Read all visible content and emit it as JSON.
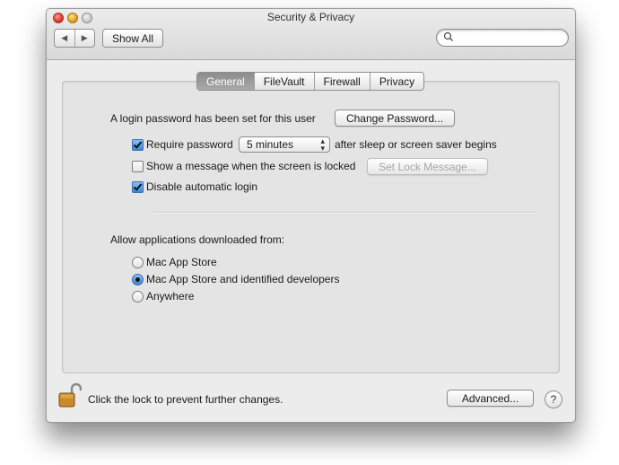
{
  "window": {
    "title": "Security & Privacy",
    "nav_back": "◀",
    "nav_forward": "▶",
    "show_all_label": "Show All",
    "search_placeholder": ""
  },
  "tabs": [
    {
      "label": "General",
      "selected": true
    },
    {
      "label": "FileVault",
      "selected": false
    },
    {
      "label": "Firewall",
      "selected": false
    },
    {
      "label": "Privacy",
      "selected": false
    }
  ],
  "general": {
    "login_password_text": "A login password has been set for this user",
    "change_password_label": "Change Password...",
    "require_password": {
      "checked": true,
      "label": "Require password",
      "interval": "5 minutes",
      "suffix": "after sleep or screen saver begins"
    },
    "show_message": {
      "checked": false,
      "label": "Show a message when the screen is locked",
      "button": "Set Lock Message..."
    },
    "disable_auto_login": {
      "checked": true,
      "label": "Disable automatic login"
    }
  },
  "downloads": {
    "heading": "Allow applications downloaded from:",
    "options": [
      {
        "label": "Mac App Store",
        "selected": false
      },
      {
        "label": "Mac App Store and identified developers",
        "selected": true
      },
      {
        "label": "Anywhere",
        "selected": false
      }
    ]
  },
  "footer": {
    "lock_text": "Click the lock to prevent further changes.",
    "advanced_label": "Advanced...",
    "help_label": "?"
  },
  "colors": {
    "accent": "#3b86dd",
    "window_bg": "#ececec",
    "selected_tab": "#9a9a9a"
  }
}
